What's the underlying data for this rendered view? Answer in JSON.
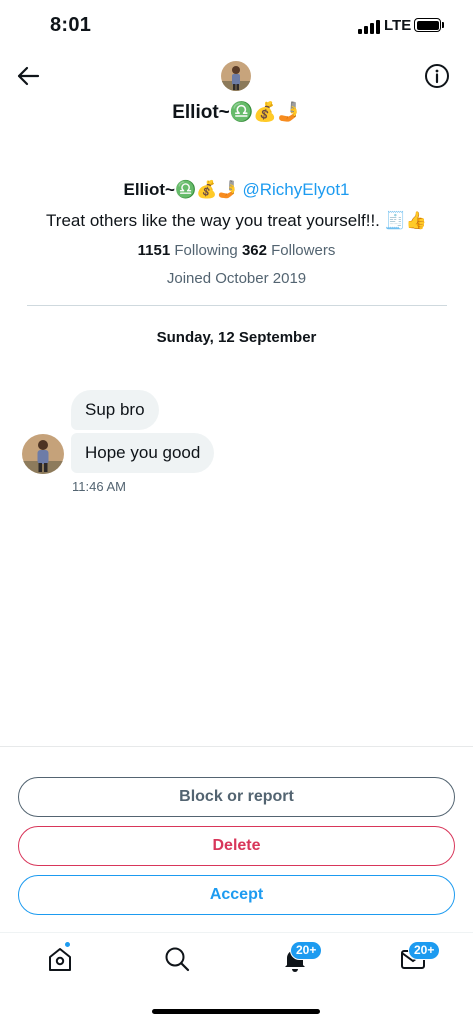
{
  "status_bar": {
    "time": "8:01",
    "network": "LTE",
    "icons": [
      "signal-bars",
      "battery-full"
    ]
  },
  "header": {
    "name": "Elliot~♎️💰🤳",
    "icons": [
      "back-arrow-icon",
      "info-icon"
    ]
  },
  "profile": {
    "name": "Elliot~♎️💰🤳",
    "handle": "@RichyElyot1",
    "bio": "Treat others like the way you treat yourself!!. 🧾👍",
    "following_count": "1151",
    "following_label": "Following",
    "followers_count": "362",
    "followers_label": "Followers",
    "joined": "Joined October 2019"
  },
  "conversation": {
    "date": "Sunday, 12 September",
    "messages": [
      {
        "text": "Sup bro"
      },
      {
        "text": "Hope you good"
      }
    ],
    "time": "11:46 AM"
  },
  "actions": {
    "block_label": "Block or report",
    "delete_label": "Delete",
    "accept_label": "Accept"
  },
  "tab_bar": {
    "notifications_badge": "20+",
    "messages_badge": "20+",
    "icons": [
      "home-icon",
      "search-icon",
      "bell-icon",
      "mail-icon"
    ]
  },
  "colors": {
    "accent": "#1d9bf0",
    "danger": "#d8365a",
    "muted": "#536471",
    "bubble": "#eff3f4"
  }
}
